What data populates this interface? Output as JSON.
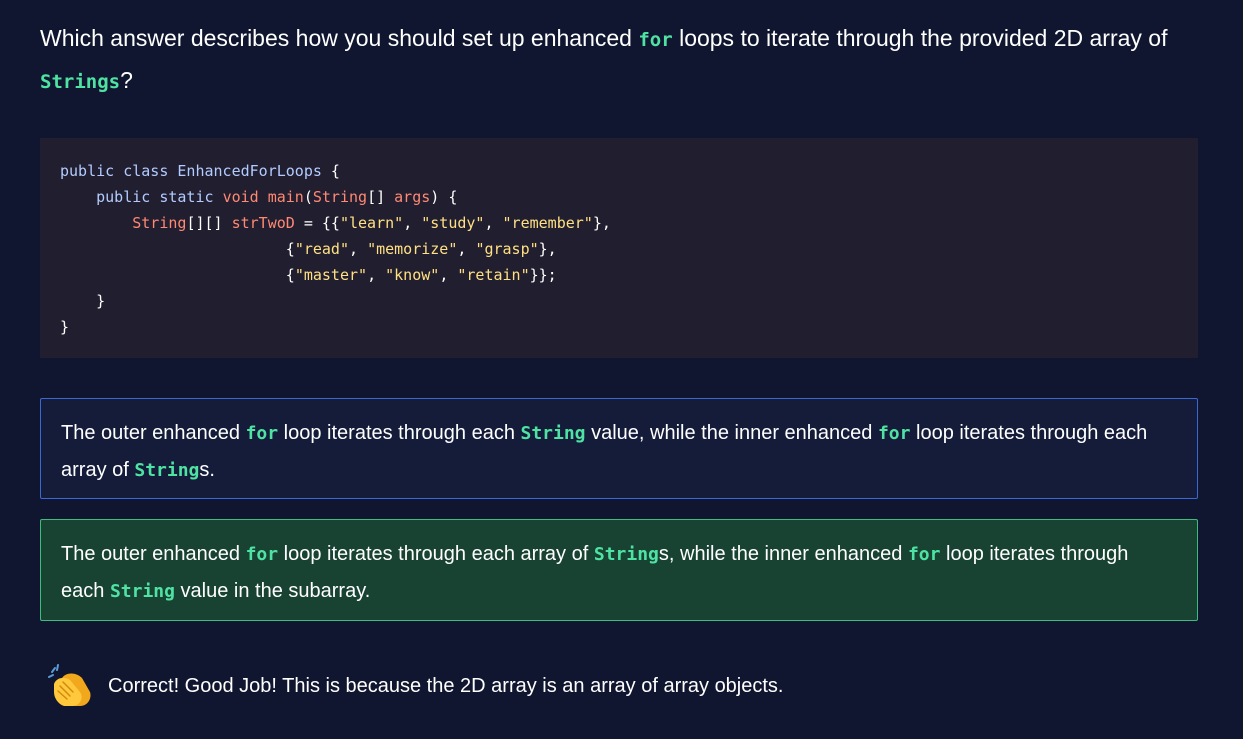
{
  "question": {
    "p1": "Which answer describes how you should set up enhanced ",
    "kw1": "for",
    "p2": " loops to iterate through the provided 2D array of ",
    "kw2": "Strings",
    "p3": "?"
  },
  "code": {
    "l1_kw": "public class",
    "l1_name": "EnhancedForLoops",
    "l1_punc": " {",
    "l2_kw": "public static",
    "l2_type": "void",
    "l2_fn": "main",
    "l2_p1": "(",
    "l2_type2": "String",
    "l2_p2": "[] ",
    "l2_var": "args",
    "l2_p3": ") {",
    "l3_type": "String",
    "l3_p1": "[][] ",
    "l3_var": "strTwoD",
    "l3_p2": " = {{",
    "l3_s1": "\"learn\"",
    "l3_c1": ", ",
    "l3_s2": "\"study\"",
    "l3_c2": ", ",
    "l3_s3": "\"remember\"",
    "l3_p3": "},",
    "l4_p1": "{",
    "l4_s1": "\"read\"",
    "l4_c1": ", ",
    "l4_s2": "\"memorize\"",
    "l4_c2": ", ",
    "l4_s3": "\"grasp\"",
    "l4_p2": "},",
    "l5_p1": "{",
    "l5_s1": "\"master\"",
    "l5_c1": ", ",
    "l5_s2": "\"know\"",
    "l5_c2": ", ",
    "l5_s3": "\"retain\"",
    "l5_p2": "}};",
    "l6": "}",
    "l7": "}"
  },
  "options": [
    {
      "t1": "The outer enhanced ",
      "k1": "for",
      "t2": " loop iterates through each ",
      "k2": "String",
      "t3": " value, while the inner enhanced ",
      "k3": "for",
      "t4": " loop iterates through each array of ",
      "k4": "String",
      "t5": "s."
    },
    {
      "t1": "The outer enhanced ",
      "k1": "for",
      "t2": " loop iterates through each array of ",
      "k2": "String",
      "t3": "s, while the inner enhanced ",
      "k3": "for",
      "t4": " loop iterates through each ",
      "k4": "String",
      "t5": " value in the subarray."
    }
  ],
  "feedback": {
    "icon": "clapping-hands-icon",
    "text": "Correct! Good Job! This is because the 2D array is an array of array objects."
  },
  "colors": {
    "background": "#10162f",
    "keyword": "#4fe3a3",
    "option_border": "#3a68d6",
    "correct_bg": "#184333",
    "correct_border": "#3ebc7f",
    "code_bg": "#211e2f"
  }
}
